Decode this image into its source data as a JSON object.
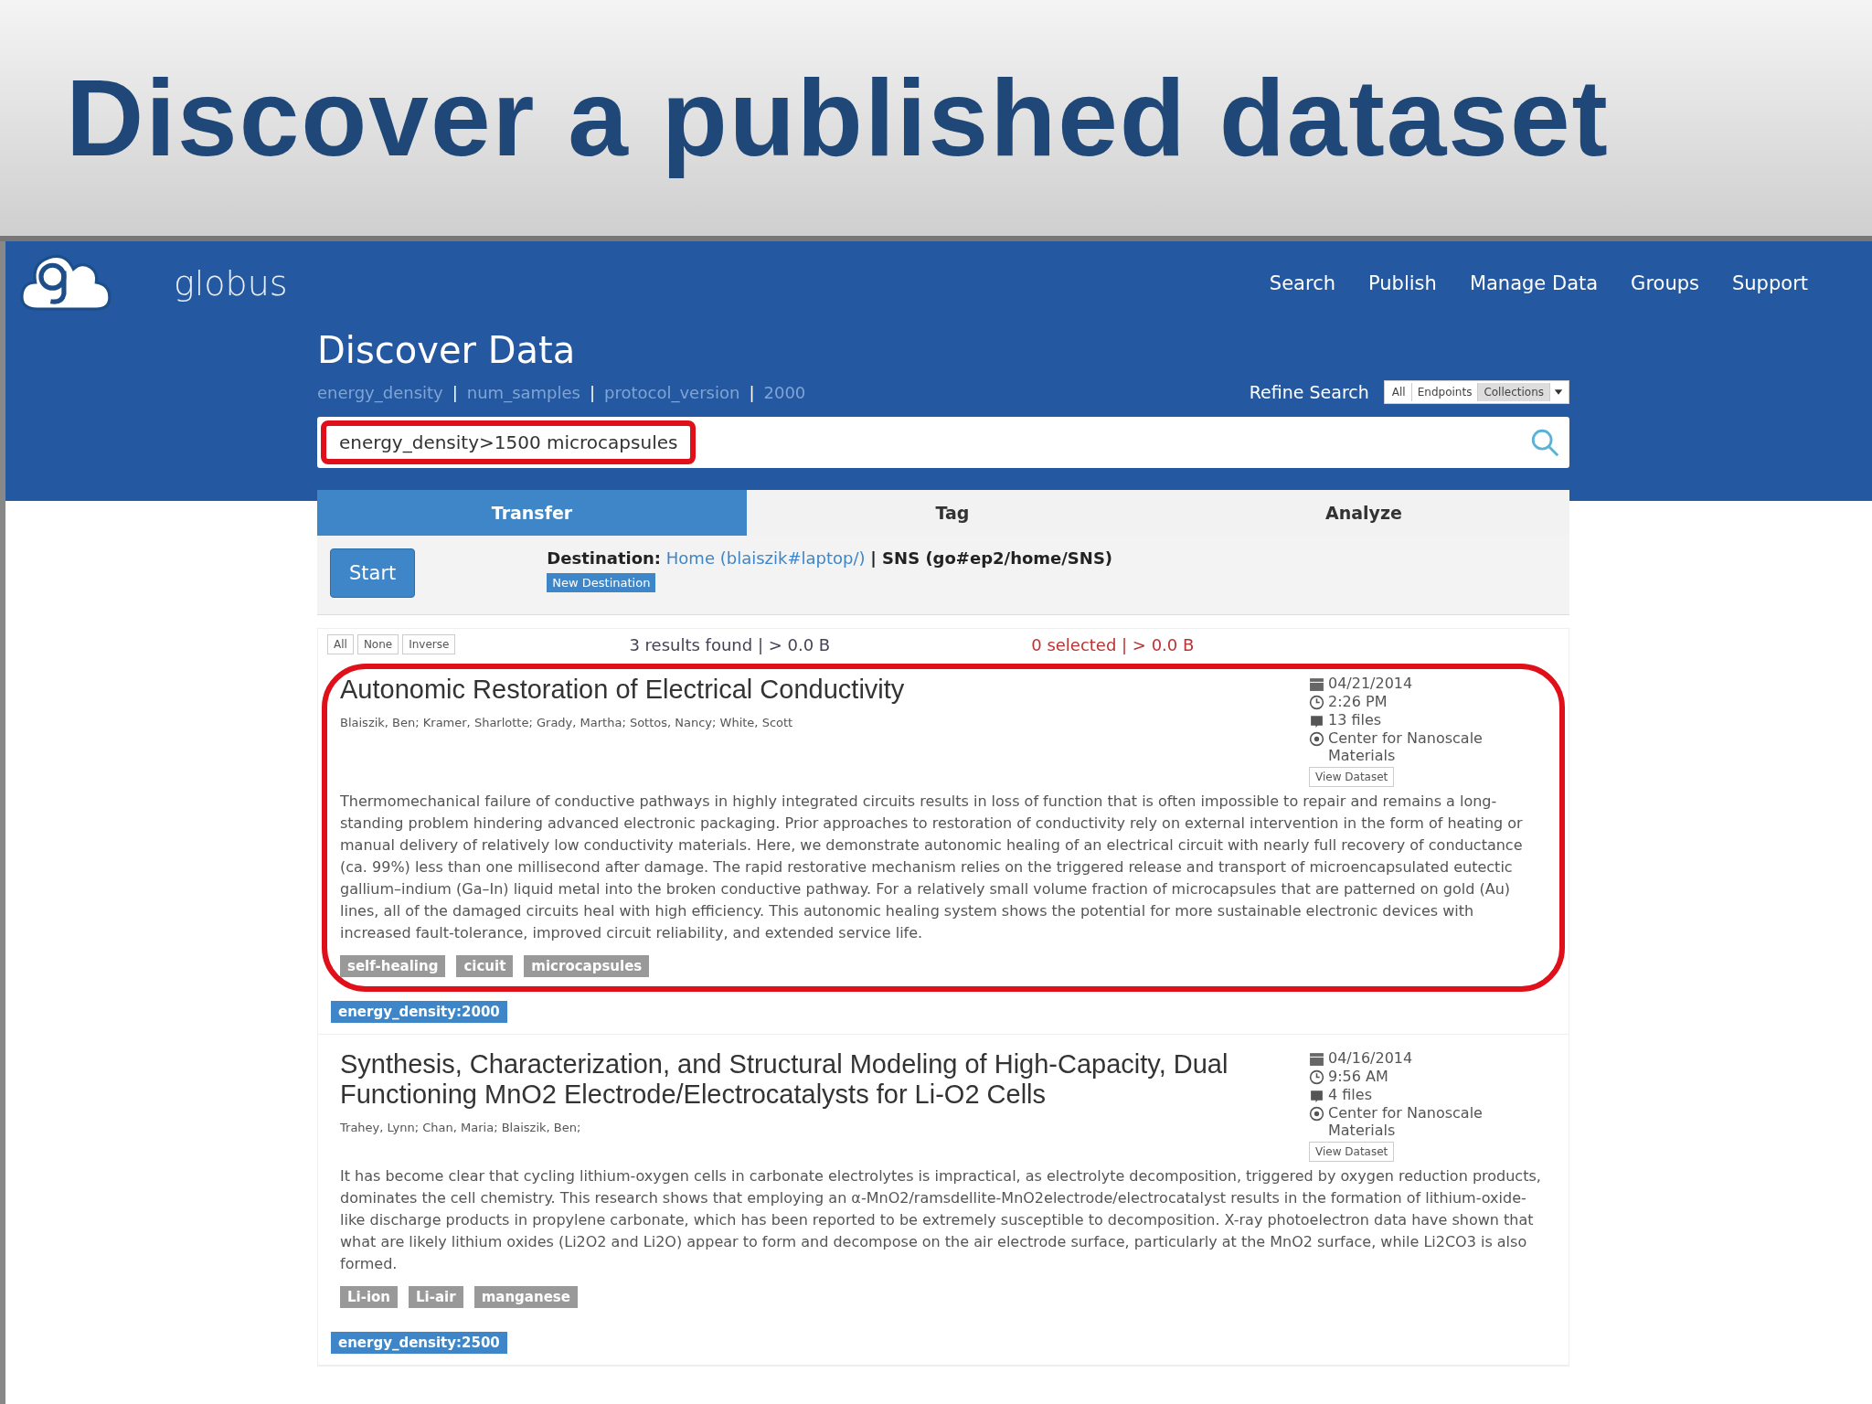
{
  "slide_title": "Discover a published dataset",
  "header": {
    "brand": "globus",
    "nav": [
      "Search",
      "Publish",
      "Manage Data",
      "Groups",
      "Support"
    ]
  },
  "page_title": "Discover Data",
  "facets": [
    "energy_density",
    "num_samples",
    "protocol_version",
    "2000"
  ],
  "facet_separator": "|",
  "refine": {
    "label": "Refine Search",
    "options": [
      {
        "label": "All",
        "selected": false
      },
      {
        "label": "Endpoints",
        "selected": false
      },
      {
        "label": "Collections",
        "selected": true
      }
    ]
  },
  "search": {
    "value": "energy_density>1500 microcapsules",
    "highlighted": true
  },
  "tabs": [
    {
      "label": "Transfer",
      "selected": true
    },
    {
      "label": "Tag",
      "selected": false
    },
    {
      "label": "Analyze",
      "selected": false
    }
  ],
  "transfer": {
    "button": "Start",
    "destination_label": "Destination:",
    "destination_link": "Home (blaiszik#laptop/)",
    "destination_rest": "| SNS (go#ep2/home/SNS)",
    "new_destination": "New Destination"
  },
  "results_bar": {
    "select_buttons": [
      "All",
      "None",
      "Inverse"
    ],
    "found": "3 results found | > 0.0 B",
    "selected": "0 selected | > 0.0 B"
  },
  "results": [
    {
      "title": "Autonomic Restoration of Electrical Conductivity",
      "highlighted": true,
      "authors": "Blaiszik, Ben;  Kramer, Sharlotte;  Grady, Martha;  Sottos, Nancy;  White, Scott",
      "date": "04/21/2014",
      "time": "2:26 PM",
      "files": "13 files",
      "org": "Center for Nanoscale Materials",
      "view": "View Dataset",
      "abstract": "Thermomechanical failure of conductive pathways in highly integrated circuits results in loss of function that is often impossible to repair and remains a long-standing problem hindering advanced electronic packaging. Prior approaches to restoration of conductivity rely on external intervention in the form of heating or manual delivery of relatively low conductivity materials. Here, we demonstrate autonomic healing of an electrical circuit with nearly full recovery of conductance (ca. 99%) less than one millisecond after damage. The rapid restorative mechanism relies on the triggered release and transport of microencapsulated eutectic gallium–indium (Ga–In) liquid metal into the broken conductive pathway. For a relatively small volume fraction of microcapsules that are patterned on gold (Au) lines, all of the damaged circuits heal with high efficiency. This autonomic healing system shows the potential for more sustainable electronic devices with increased fault-tolerance, improved circuit reliability, and extended service life.",
      "tags": [
        "self-healing",
        "cicuit",
        "microcapsules"
      ],
      "facet_tag": "energy_density:2000"
    },
    {
      "title": "Synthesis, Characterization, and Structural Modeling of High-Capacity, Dual Functioning MnO2 Electrode/Electrocatalysts for Li-O2 Cells",
      "highlighted": false,
      "authors": "Trahey, Lynn;  Chan, Maria;  Blaiszik, Ben;",
      "date": "04/16/2014",
      "time": "9:56 AM",
      "files": "4 files",
      "org": "Center for Nanoscale Materials",
      "view": "View Dataset",
      "abstract": "It has become clear that cycling lithium-oxygen cells in carbonate electrolytes is impractical, as electrolyte decomposition, triggered by oxygen reduction products, dominates the cell chemistry. This research shows that employing an α-MnO2/ramsdellite-MnO2electrode/electrocatalyst results in the formation of lithium-oxide-like discharge products in propylene carbonate, which has been reported to be extremely susceptible to decomposition. X-ray photoelectron data have shown that what are likely lithium oxides (Li2O2 and Li2O) appear to form and decompose on the air electrode surface, particularly at the MnO2 surface, while Li2CO3 is also formed.",
      "tags": [
        "Li-ion",
        "Li-air",
        "manganese"
      ],
      "facet_tag": "energy_density:2500"
    }
  ]
}
